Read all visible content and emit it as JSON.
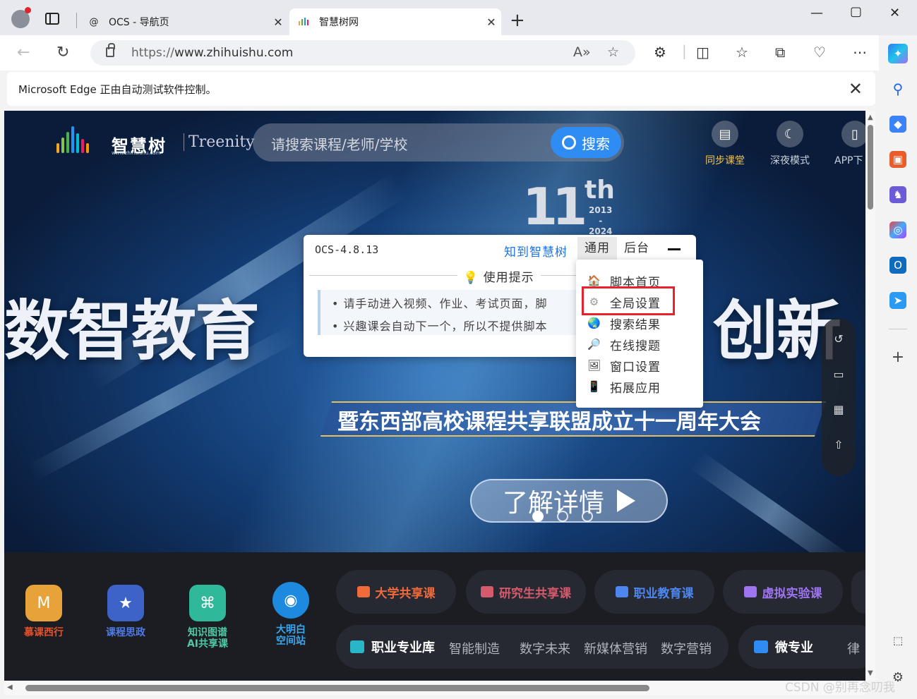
{
  "browser": {
    "tabs": [
      {
        "title": "OCS - 导航页",
        "favicon": "at-sign-icon"
      },
      {
        "title": "智慧树网",
        "favicon": "zhihuishu-icon",
        "active": true
      }
    ],
    "url_prefix": "https://",
    "url_host": "www.zhihuishu.com",
    "infobar_message": "Microsoft Edge 正由自动测试软件控制。"
  },
  "site": {
    "logo_name": "智慧树",
    "logo_domain": "www.zhihuishu.com",
    "logo_brand": "Treenity",
    "search_placeholder": "请搜索课程/老师/学校",
    "search_button": "搜索",
    "top_links": [
      {
        "label": "同步课堂",
        "active": true
      },
      {
        "label": "深夜模式"
      },
      {
        "label": "APP下"
      }
    ],
    "banner": {
      "anniversary_number": "11",
      "anniversary_suffix": "th",
      "year_start": "2013",
      "year_dash": "-",
      "year_end": "2024",
      "slogan_left": "数智教育",
      "slogan_right": "创新",
      "subtitle": "暨东西部高校课程共享联盟成立十一周年大会",
      "cta": "了解详情",
      "slides": 3,
      "active_slide": 1
    },
    "apps": [
      {
        "label": "慕课西行",
        "color": "#e5522b"
      },
      {
        "label": "课程思政",
        "color": "#4e7be8"
      },
      {
        "label": "知识图谱\nAI共享课",
        "color": "#4dc9a6"
      },
      {
        "label": "大明白\n空间站",
        "color": "#3aa6f0"
      }
    ],
    "pills": [
      {
        "label": "大学共享课",
        "color": "#f06a3a"
      },
      {
        "label": "研究生共享课",
        "color": "#d55a6b"
      },
      {
        "label": "职业教育课",
        "color": "#4e86f0"
      },
      {
        "label": "虚拟实验课",
        "color": "#9f74f0"
      }
    ],
    "category_main": "职业专业库",
    "category_items": [
      "智能制造",
      "数字未来",
      "新媒体营销",
      "数字营销"
    ],
    "micro_main": "微专业",
    "micro_next": "律"
  },
  "ocs": {
    "version": "OCS-4.8.13",
    "link": "知到智慧树",
    "tab_general": "通用",
    "tab_backend": "后台",
    "tip_heading": "使用提示",
    "tip_lines": [
      "• 请手动进入视频、作业、考试页面，脚",
      "• 兴趣课会自动下一个，所以不提供脚本"
    ],
    "menu": [
      {
        "label": "脚本首页",
        "icon": "house-icon"
      },
      {
        "label": "全局设置",
        "icon": "gear-icon",
        "highlighted": true
      },
      {
        "label": "搜索结果",
        "icon": "globe-icon"
      },
      {
        "label": "在线搜题",
        "icon": "magnifier-icon"
      },
      {
        "label": "窗口设置",
        "icon": "picture-icon"
      },
      {
        "label": "拓展应用",
        "icon": "phone-icon"
      }
    ]
  },
  "watermark": "CSDN @别再念叨我",
  "accent": {
    "highlight_red": "#e8222a",
    "link_blue": "#1a73e8",
    "search_blue": "#2f8cf2"
  }
}
